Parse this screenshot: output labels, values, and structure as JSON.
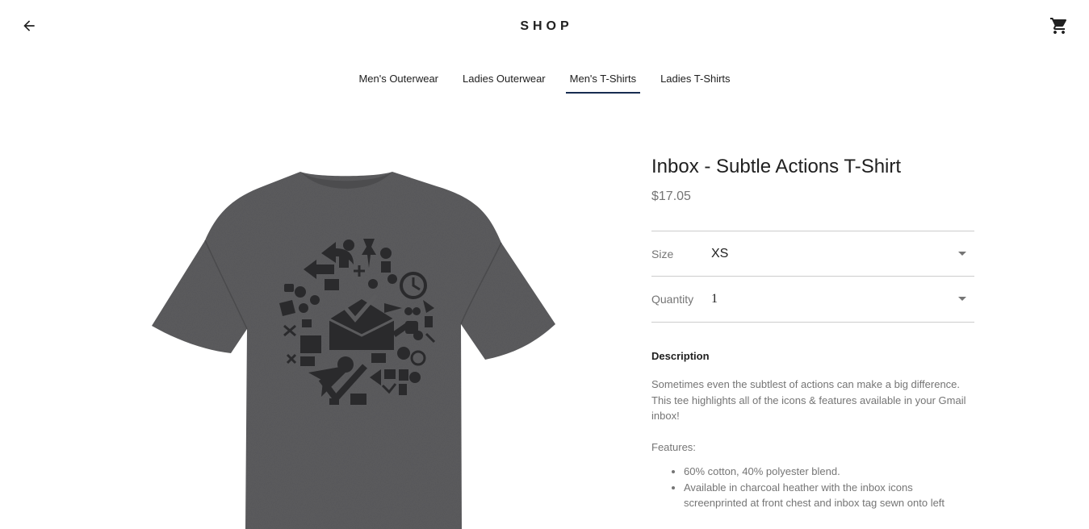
{
  "header": {
    "back_icon": "arrow-back-icon",
    "title": "SHOP",
    "cart_icon": "shopping-cart-icon"
  },
  "tabs": [
    {
      "label": "Men's Outerwear",
      "active": false
    },
    {
      "label": "Ladies Outerwear",
      "active": false
    },
    {
      "label": "Men's T-Shirts",
      "active": true
    },
    {
      "label": "Ladies T-Shirts",
      "active": false
    }
  ],
  "product": {
    "title": "Inbox - Subtle Actions T-Shirt",
    "price": "$17.05",
    "size_label": "Size",
    "size_value": "XS",
    "quantity_label": "Quantity",
    "quantity_value": "1",
    "description_heading": "Description",
    "description": "Sometimes even the subtlest of actions can make a big difference. This tee highlights all of the icons & features available in your Gmail inbox!",
    "features_label": "Features:",
    "features": [
      "60% cotton, 40% polyester blend.",
      "Available in charcoal heather with the inbox icons screenprinted at front chest and inbox tag sewn onto left"
    ]
  },
  "colors": {
    "accent": "#172c50",
    "text": "#202020",
    "secondary_text": "#757575",
    "divider": "#cccccc",
    "shirt": "#5b5b5d",
    "print": "#2a2a2c"
  }
}
